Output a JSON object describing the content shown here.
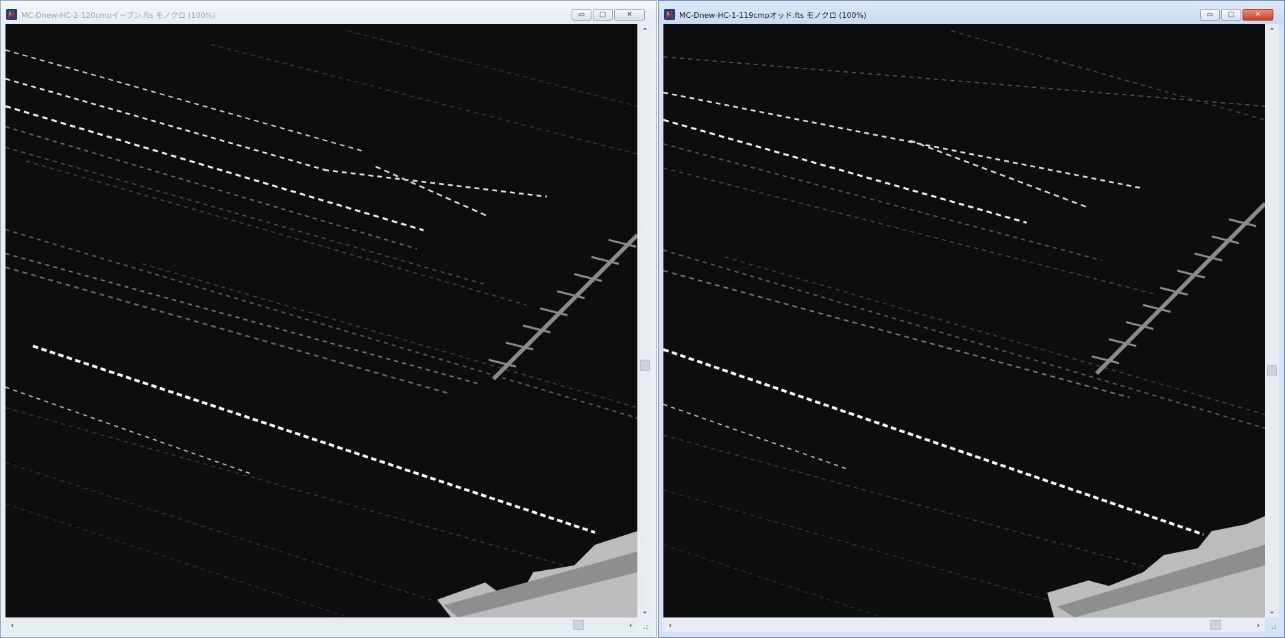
{
  "windows": [
    {
      "id": "left",
      "title": "MC-Dnew-HC-2-120cmpイーブン.fts モノクロ (100%)",
      "active": false,
      "controls": {
        "minimize": "▭",
        "maximize": "□",
        "close": "✕"
      }
    },
    {
      "id": "right",
      "title": "MC-Dnew-HC-1-119cmpオッド.fts モノクロ (100%)",
      "active": true,
      "controls": {
        "minimize": "▭",
        "maximize": "□",
        "close": "✕"
      }
    }
  ],
  "scroll": {
    "up": "⌃",
    "down": "⌄",
    "left": "‹",
    "right": "›"
  },
  "colors": {
    "image_background": "#0d0d0d",
    "star_trail": "#e8e8e8",
    "accent_close": "#c7432c"
  },
  "icons": [
    "app-icon",
    "minimize-icon",
    "maximize-icon",
    "close-icon",
    "scroll-up-icon",
    "scroll-down-icon",
    "scroll-left-icon",
    "scroll-right-icon",
    "resize-grip-icon"
  ]
}
